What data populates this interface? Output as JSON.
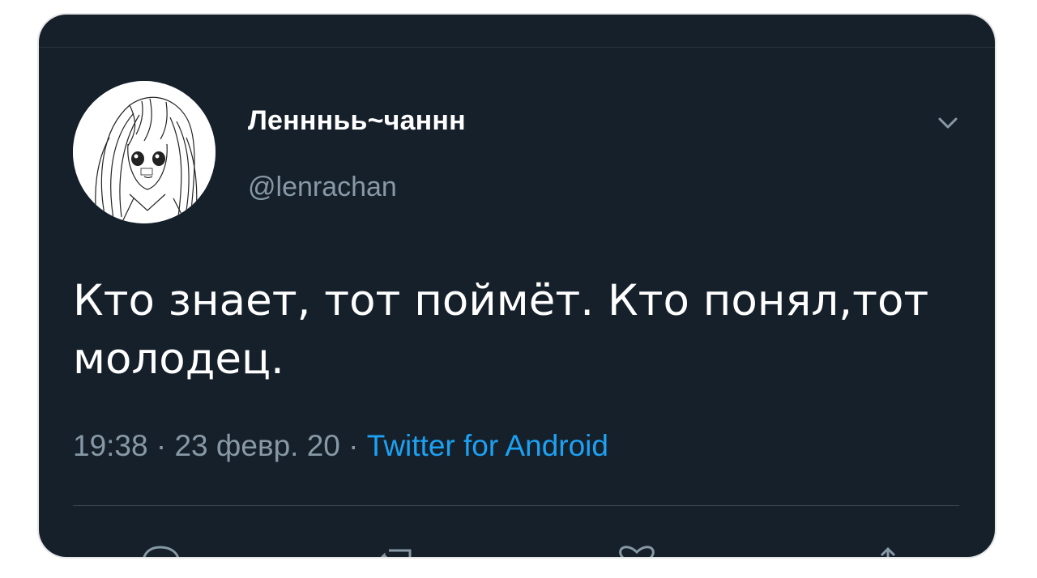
{
  "tweet": {
    "author": {
      "display_name": "Леннньь~чаннн",
      "handle": "@lenrachan"
    },
    "text": "Кто знает, тот поймёт. Кто понял,тот молодец.",
    "time": "19:38",
    "date": "23 февр. 20",
    "separator": "·",
    "source": "Twitter for Android"
  },
  "icons": {
    "menu": "chevron-down-icon",
    "actions": [
      "reply-icon",
      "retweet-icon",
      "like-icon",
      "share-icon"
    ]
  },
  "colors": {
    "background": "#15202b",
    "text": "#ffffff",
    "secondary_text": "#8899a6",
    "link": "#1da1f2",
    "divider": "#38444d"
  }
}
